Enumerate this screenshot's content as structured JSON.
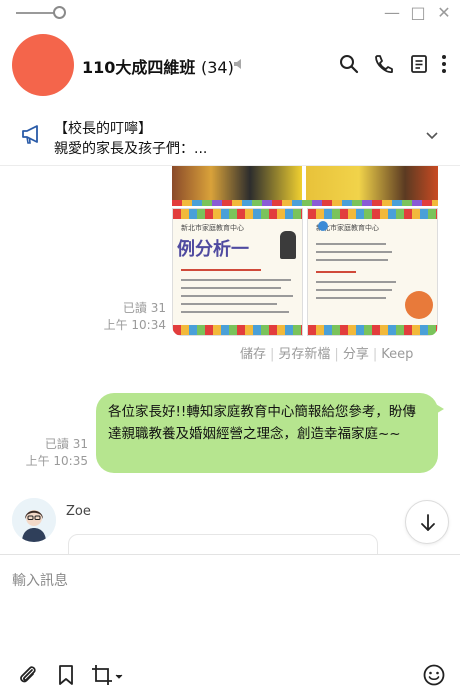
{
  "window": {
    "minimize": "—",
    "maximize": "□",
    "close": "✕"
  },
  "header": {
    "group_name": "110大成四維班",
    "member_count": "(34)",
    "avatar_color": "#f4654b"
  },
  "announcement": {
    "title": "【校長的叮嚀】",
    "body": "親愛的家長及孩子們：..."
  },
  "messages": {
    "image_message": {
      "slide_left_heading": "新北市家庭教育中心",
      "slide_left_title": "例分析一",
      "slide_right_heading": "新北市家庭教育中心",
      "read_status": "已讀 31",
      "time": "上午 10:34"
    },
    "image_actions": [
      "儲存",
      "另存新檔",
      "分享",
      "Keep"
    ],
    "text_message": {
      "text": "各位家長好!!轉知家庭教育中心簡報給您參考，盼傳達親職教養及婚姻經營之理念，創造幸福家庭~~",
      "read_status": "已讀 31",
      "time": "上午 10:35",
      "bubble_color": "#b6e58f"
    },
    "incoming": {
      "sender": "Zoe"
    }
  },
  "input": {
    "placeholder": "輸入訊息"
  },
  "icons": {
    "mute": "speaker-muted-icon",
    "search": "search-icon",
    "call": "phone-icon",
    "notes": "notes-icon",
    "menu": "more-vertical-icon",
    "announce": "megaphone-icon",
    "expand": "chevron-down-icon",
    "scroll": "arrow-down-icon",
    "attach": "paperclip-icon",
    "bookmark": "bookmark-icon",
    "crop": "crop-icon",
    "emoji": "emoji-icon"
  }
}
